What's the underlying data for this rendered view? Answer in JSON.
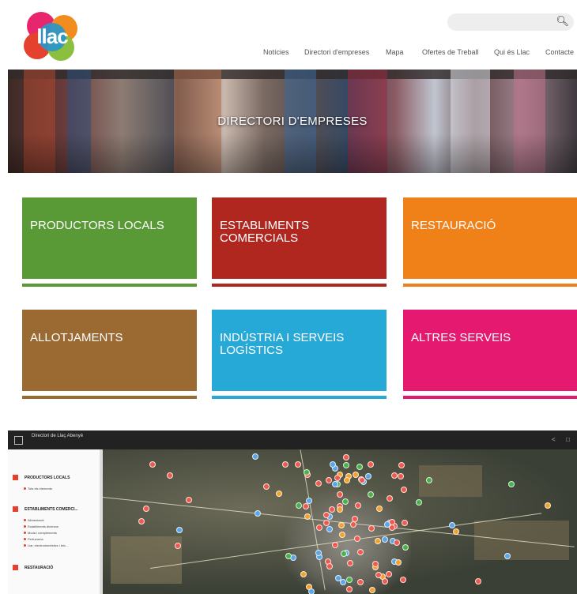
{
  "header": {
    "logo_text": "llac",
    "search_icon": "search-icon",
    "nav": [
      "Notícies",
      "Directori d'empreses",
      "Mapa",
      "Ofertes de Treball",
      "Qui és Llac",
      "Contacte"
    ]
  },
  "banner": {
    "title": "DIRECTORI D'EMPRESES"
  },
  "categories": [
    {
      "label": "PRODUCTORS LOCALS",
      "color": "#5a9a36"
    },
    {
      "label": "ESTABLIMENTS COMERCIALS",
      "color": "#b0271f"
    },
    {
      "label": "RESTAURACIÓ",
      "color": "#f08119"
    },
    {
      "label": "ALLOTJAMENTS",
      "color": "#9b6a33"
    },
    {
      "label": "INDÚSTRIA I SERVEIS LOGÍSTICS",
      "color": "#26a9d7"
    },
    {
      "label": "ALTRES SERVEIS",
      "color": "#e5196f"
    }
  ],
  "map_screenshot": {
    "title": "Directori de Llaç Abenyé",
    "subtitle": "",
    "sidebar": {
      "head": "",
      "groups": [
        {
          "label": "PRODUCTORS LOCALS",
          "items": [
            "Tots els elements"
          ]
        },
        {
          "label": "ESTABLIMENTS COMERCI...",
          "items": [
            "Alimentació",
            "Establiments diversos",
            "Moda i complements",
            "Perfumeria",
            "Llar, electrodomèstics i bric..."
          ]
        },
        {
          "label": "RESTAURACIÓ",
          "items": []
        }
      ]
    }
  }
}
